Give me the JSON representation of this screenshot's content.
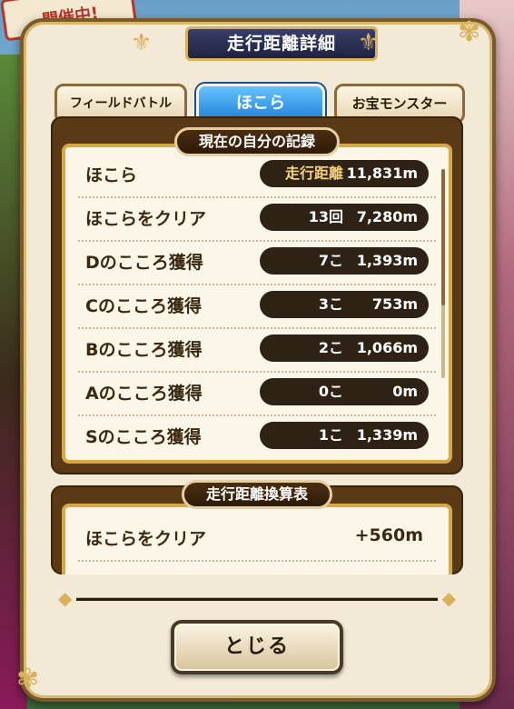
{
  "background": {
    "sign_text": "開催中!"
  },
  "dialog": {
    "title": "走行距離詳細",
    "tabs": [
      {
        "label": "フィールドバトル",
        "active": false
      },
      {
        "label": "ほこら",
        "active": true
      },
      {
        "label": "お宝モンスター",
        "active": false
      }
    ],
    "record_section": {
      "heading": "現在の自分の記録",
      "rows": [
        {
          "label": "ほこら",
          "count": "走行距離",
          "distance": "11,831m"
        },
        {
          "label": "ほこらをクリア",
          "count": "13回",
          "distance": "7,280m"
        },
        {
          "label": "Dのこころ獲得",
          "count": "7こ",
          "distance": "1,393m"
        },
        {
          "label": "Cのこころ獲得",
          "count": "3こ",
          "distance": "753m"
        },
        {
          "label": "Bのこころ獲得",
          "count": "2こ",
          "distance": "1,066m"
        },
        {
          "label": "Aのこころ獲得",
          "count": "0こ",
          "distance": "0m"
        },
        {
          "label": "Sのこころ獲得",
          "count": "1こ",
          "distance": "1,339m"
        }
      ]
    },
    "conversion_section": {
      "heading": "走行距離換算表",
      "rows": [
        {
          "label": "ほこらをクリア",
          "value": "+560m"
        }
      ]
    },
    "close_label": "とじる"
  },
  "colors": {
    "accent_gold": "#d8b25a",
    "tab_active": "#1f7fd6",
    "panel_brown": "#5a3a16"
  }
}
